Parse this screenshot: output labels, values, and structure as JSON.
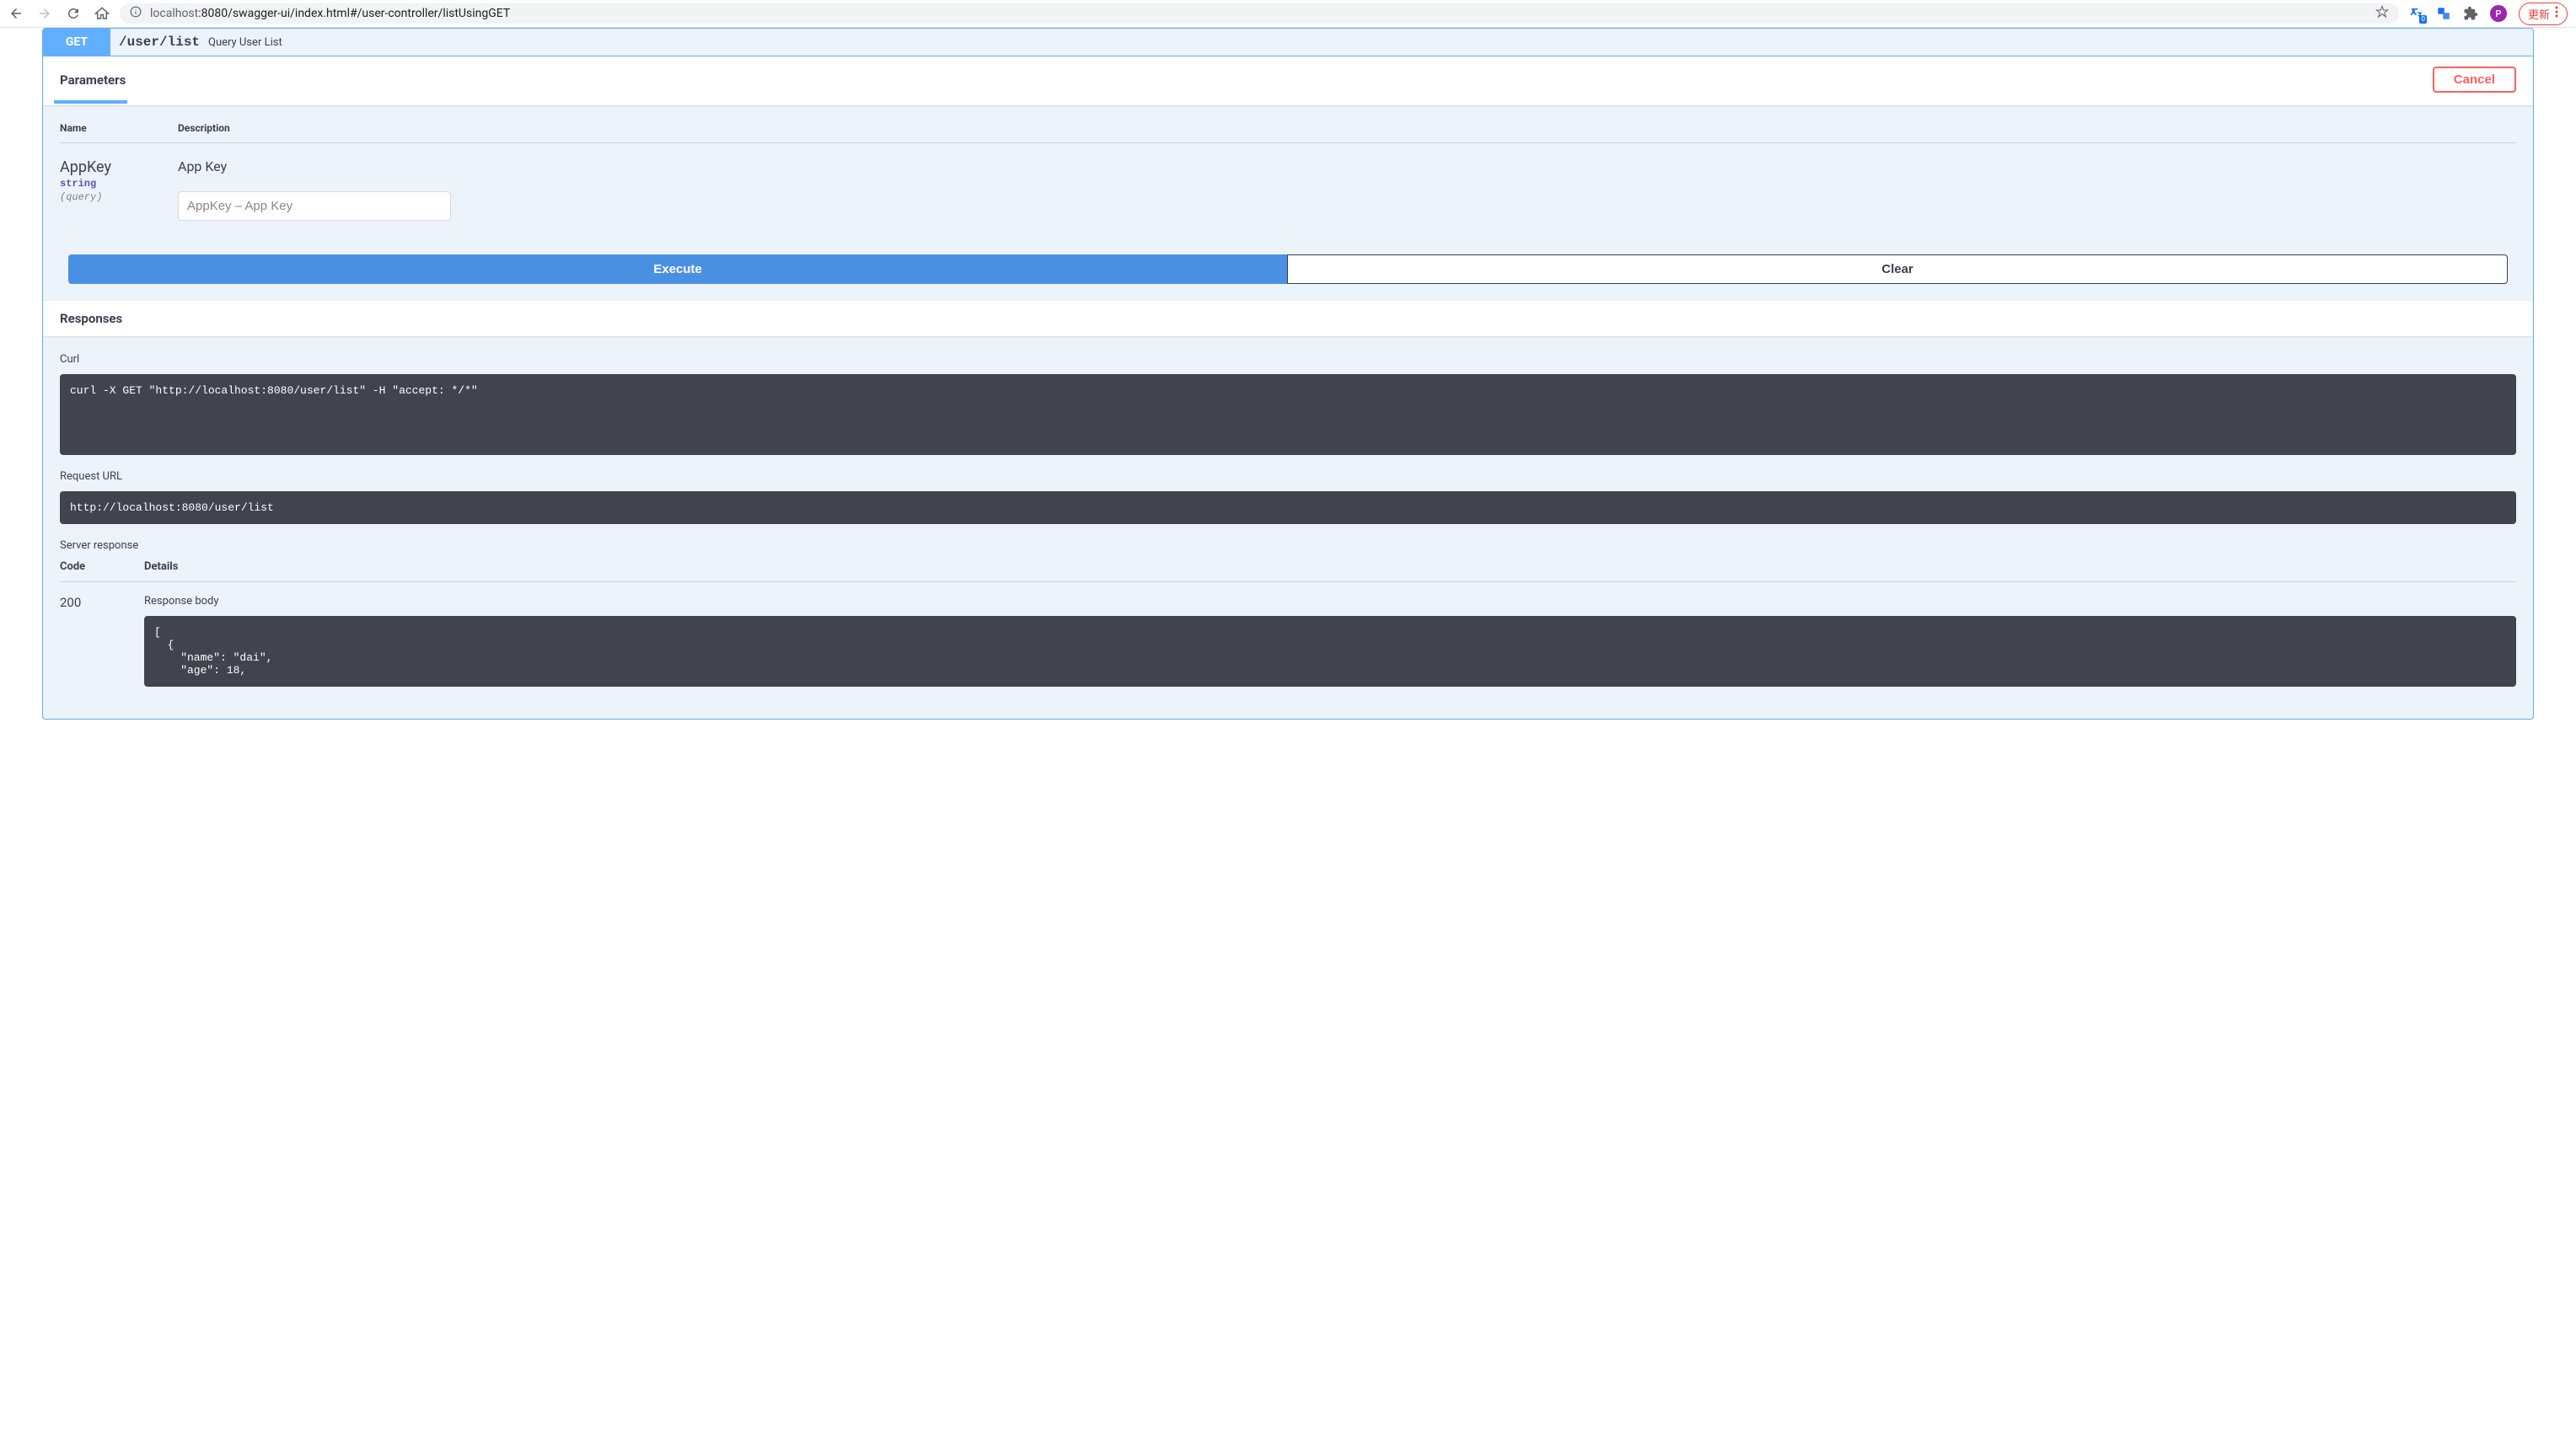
{
  "browser": {
    "url_prefix": "localhost",
    "url_rest": ":8080/swagger-ui/index.html#/user-controller/listUsingGET",
    "translate_badge": "0",
    "avatar_initial": "P",
    "update_label": "更新"
  },
  "operation": {
    "method": "GET",
    "path": "/user/list",
    "summary": "Query User List"
  },
  "parameters": {
    "section_title": "Parameters",
    "cancel_label": "Cancel",
    "col_name": "Name",
    "col_desc": "Description",
    "items": [
      {
        "name": "AppKey",
        "type": "string",
        "in": "(query)",
        "desc": "App Key",
        "placeholder": "AppKey – App Key"
      }
    ]
  },
  "buttons": {
    "execute": "Execute",
    "clear": "Clear"
  },
  "responses": {
    "section_title": "Responses",
    "curl_label": "Curl",
    "curl": "curl -X GET \"http://localhost:8080/user/list\" -H \"accept: */*\"",
    "request_url_label": "Request URL",
    "request_url": "http://localhost:8080/user/list",
    "server_response_label": "Server response",
    "col_code": "Code",
    "col_details": "Details",
    "code": "200",
    "body_label": "Response body",
    "body": "[\n  {\n    \"name\": \"dai\",\n    \"age\": 18,"
  }
}
